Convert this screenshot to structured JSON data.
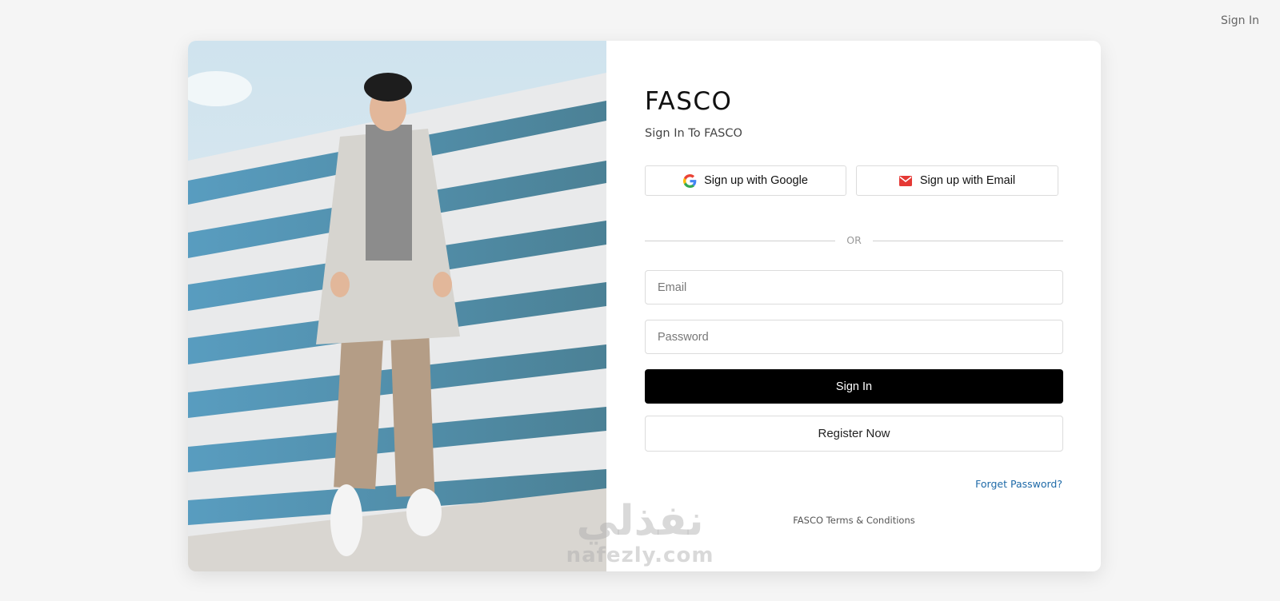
{
  "header": {
    "signin_link": "Sign In"
  },
  "brand": {
    "name": "FASCO",
    "subtitle": "Sign In To FASCO"
  },
  "social": {
    "google_label": "Sign up with Google",
    "email_label": "Sign up with Email",
    "google_icon": "google-g-icon",
    "email_icon": "mail-envelope-icon"
  },
  "divider_label": "OR",
  "form": {
    "email_placeholder": "Email",
    "email_value": "",
    "password_placeholder": "Password",
    "password_value": "",
    "signin_label": "Sign In",
    "register_label": "Register Now",
    "forgot_label": "Forget Password?"
  },
  "footer": {
    "terms_label": "FASCO Terms & Conditions"
  },
  "watermark": {
    "arabic": "نفذلي",
    "latin": "nafezly.com"
  },
  "colors": {
    "page_bg": "#f5f5f5",
    "primary_button": "#000000",
    "link": "#1e6aa8",
    "email_icon": "#e53935"
  }
}
